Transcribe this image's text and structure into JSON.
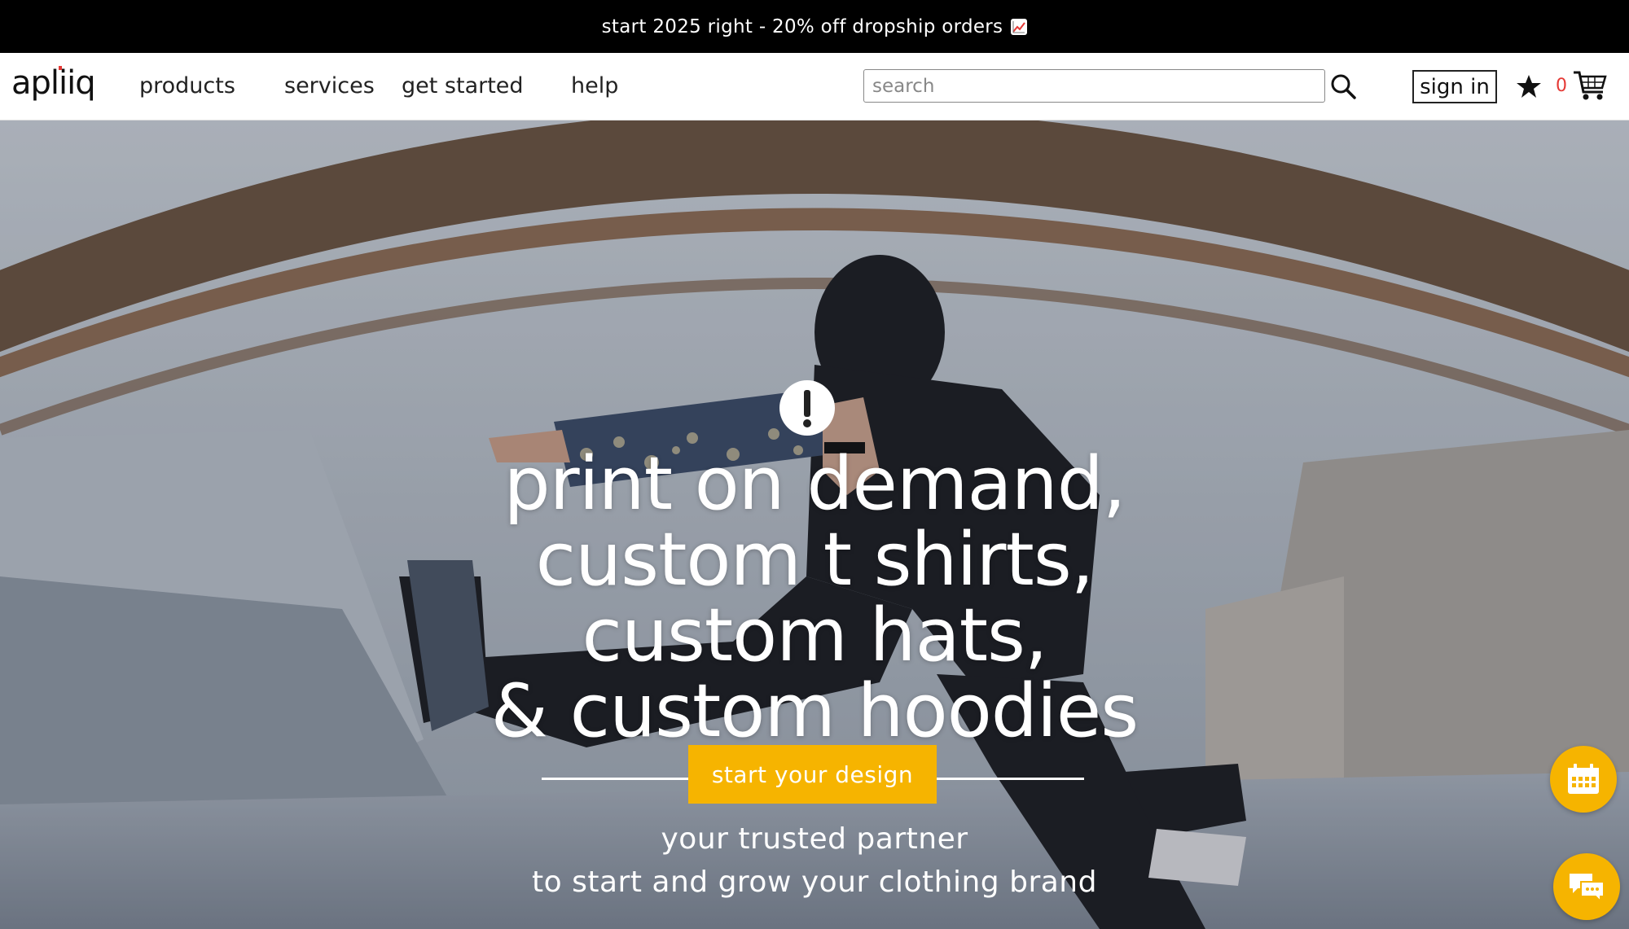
{
  "promo": {
    "text": "start 2025 right - 20% off dropship orders",
    "icon": "chart-increasing-emoji"
  },
  "header": {
    "logo_text": "apliiq",
    "nav": [
      {
        "label": "products"
      },
      {
        "label": "services"
      },
      {
        "label": "get started"
      },
      {
        "label": "help"
      }
    ],
    "search": {
      "placeholder": "search",
      "value": ""
    },
    "signin_label": "sign in",
    "cart_count": "0"
  },
  "hero": {
    "headline": [
      "print on demand,",
      "custom t shirts,",
      "custom hats,",
      "& custom hoodies"
    ],
    "cta_label": "start your design",
    "tagline": [
      "your trusted partner",
      "to start and grow your clothing brand"
    ]
  },
  "colors": {
    "accent": "#f6b400",
    "cart_count": "#e53935",
    "promo_bg": "#000000"
  },
  "floating": {
    "calendar_icon": "calendar-icon",
    "chat_icon": "chat-icon"
  }
}
